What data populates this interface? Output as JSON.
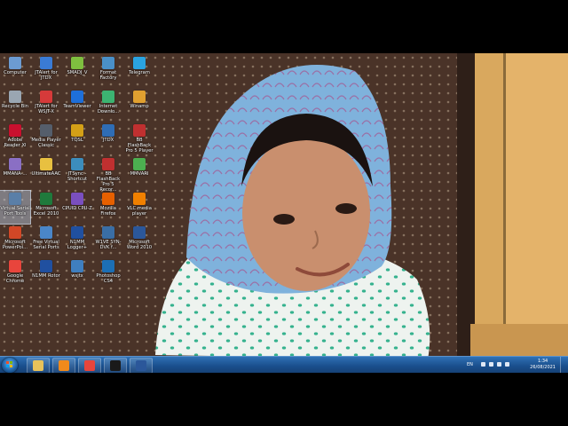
{
  "desktop": {
    "icons": [
      {
        "label": "Computer",
        "color": "#6c9bd2"
      },
      {
        "label": "JTAlert for JTDX",
        "color": "#3a7bd5"
      },
      {
        "label": "SMADJ_V",
        "color": "#7fbf3f"
      },
      {
        "label": "Format Factory",
        "color": "#4a90c8"
      },
      {
        "label": "Telegram",
        "color": "#2aa3e0"
      },
      {
        "label": "Recycle Bin",
        "color": "#9aa6b2"
      },
      {
        "label": "JTAlert for WSJT-X",
        "color": "#d63a3a"
      },
      {
        "label": "TeamViewer",
        "color": "#1e6fd9"
      },
      {
        "label": "Internet Downlo...",
        "color": "#3cb371"
      },
      {
        "label": "Winamp",
        "color": "#e0a030"
      },
      {
        "label": "Adobe Reader XI",
        "color": "#c8102e"
      },
      {
        "label": "Media Player Classic",
        "color": "#555e6b"
      },
      {
        "label": "TQSL",
        "color": "#d4a017"
      },
      {
        "label": "JTDX",
        "color": "#2f6db5"
      },
      {
        "label": "BB FlashBack Pro 5 Player",
        "color": "#c03030"
      },
      {
        "label": "MMANA-...",
        "color": "#8a6fc4"
      },
      {
        "label": "UltimateAAC",
        "color": "#e8c040"
      },
      {
        "label": "JTSync - Shortcut",
        "color": "#3c8dbc"
      },
      {
        "label": "BB FlashBack Pro 5 Recor...",
        "color": "#c03030"
      },
      {
        "label": "MMVARI",
        "color": "#4caf50"
      },
      {
        "label": "Virtual Serial Port Tools",
        "color": "#5a7fa8"
      },
      {
        "label": "Microsoft Excel 2010",
        "color": "#1f7a3c"
      },
      {
        "label": "CPUID CPU-Z",
        "color": "#7a4fbf"
      },
      {
        "label": "Mozilla Firefox",
        "color": "#e66000"
      },
      {
        "label": "VLC media player",
        "color": "#f08000"
      },
      {
        "label": "Microsoft PowerPoi...",
        "color": "#d24726"
      },
      {
        "label": "Free Virtual Serial Ports",
        "color": "#4a86c8"
      },
      {
        "label": "N1MM Logger+",
        "color": "#2050a0"
      },
      {
        "label": "W1VE SYN-DVK f...",
        "color": "#3a6ea5"
      },
      {
        "label": "Microsoft Word 2010",
        "color": "#2b579a"
      },
      {
        "label": "Google Chrome",
        "color": "#e8453c"
      },
      {
        "label": "N1MM Rotor",
        "color": "#2050a0"
      },
      {
        "label": "wsjtx",
        "color": "#3f7fbf"
      },
      {
        "label": "Photoshop CS4",
        "color": "#1c6fb5"
      }
    ]
  },
  "taskbar": {
    "pinned": [
      {
        "name": "explorer",
        "color": "#e8c25a"
      },
      {
        "name": "media-player",
        "color": "#f08a1c"
      },
      {
        "name": "chrome",
        "color": "#e8453c"
      },
      {
        "name": "command-prompt",
        "color": "#1a1a1a"
      },
      {
        "name": "word",
        "color": "#2b579a"
      }
    ],
    "language": "EN",
    "time": "1:34",
    "date": "26/08/2021"
  }
}
